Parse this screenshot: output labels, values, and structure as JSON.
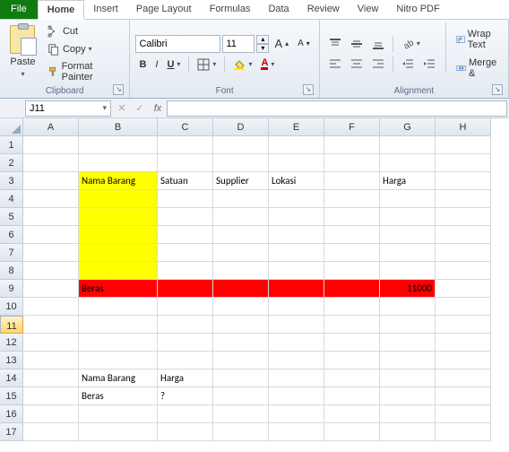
{
  "tabs": {
    "file": "File",
    "home": "Home",
    "insert": "Insert",
    "pagelayout": "Page Layout",
    "formulas": "Formulas",
    "data": "Data",
    "review": "Review",
    "view": "View",
    "nitro": "Nitro PDF"
  },
  "clipboard": {
    "paste": "Paste",
    "cut": "Cut",
    "copy": "Copy",
    "fmtpainter": "Format Painter",
    "label": "Clipboard"
  },
  "font": {
    "name": "Calibri",
    "size": "11",
    "label": "Font"
  },
  "align": {
    "wrap": "Wrap Text",
    "merge": "Merge & ",
    "label": "Alignment"
  },
  "namebox": "J11",
  "fx": "fx",
  "cols": [
    "A",
    "B",
    "C",
    "D",
    "E",
    "F",
    "G",
    "H"
  ],
  "rows": [
    "1",
    "2",
    "3",
    "4",
    "5",
    "6",
    "7",
    "8",
    "9",
    "10",
    "11",
    "12",
    "13",
    "14",
    "15",
    "16",
    "17"
  ],
  "cells": {
    "B3": "Nama Barang",
    "C3": "Satuan",
    "D3": "Supplier",
    "E3": "Lokasi",
    "G3": "Harga",
    "B9": "Beras",
    "G9": "11000",
    "B14": "Nama Barang",
    "C14": "Harga",
    "B15": "Beras",
    "C15": "?"
  }
}
